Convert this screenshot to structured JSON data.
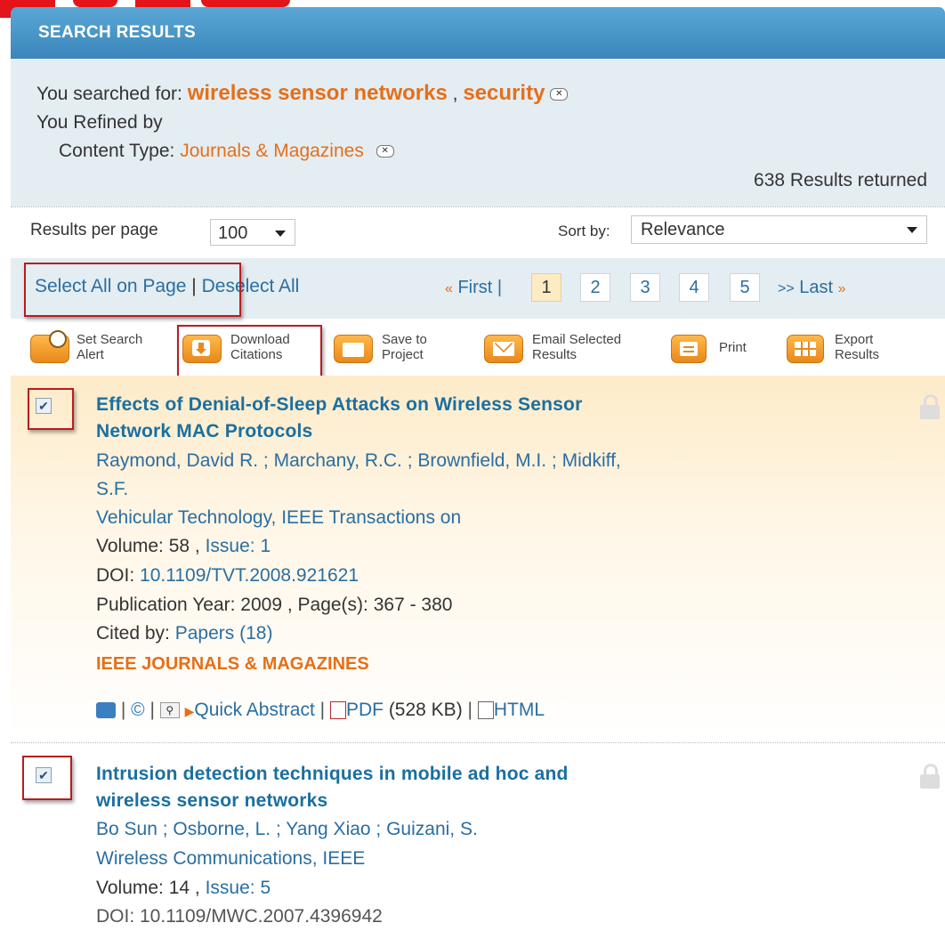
{
  "header": {
    "title": "SEARCH RESULTS"
  },
  "summary": {
    "searched_label": "You searched for:",
    "terms": [
      "wireless sensor networks",
      "security"
    ],
    "term_sep": ",",
    "refined_label": "You Refined by",
    "content_type_label": "Content Type:",
    "content_type_value": "Journals & Magazines",
    "results_count": "638 Results returned"
  },
  "controls": {
    "per_page_label": "Results per page",
    "per_page_value": "100",
    "sort_label": "Sort by:",
    "sort_value": "Relevance"
  },
  "selection": {
    "select_all": "Select All on Page",
    "separator": "|",
    "deselect_all": "Deselect All"
  },
  "pagination": {
    "first_prefix": "«",
    "first": "First",
    "first_sep": "|",
    "pages": [
      "1",
      "2",
      "3",
      "4",
      "5"
    ],
    "current": "1",
    "last_prefix": ">>",
    "last": "Last",
    "last_suffix": "»"
  },
  "toolbar": {
    "set_alert": [
      "Set Search",
      "Alert"
    ],
    "download": [
      "Download",
      "Citations"
    ],
    "save": [
      "Save to",
      "Project"
    ],
    "email": [
      "Email Selected",
      "Results"
    ],
    "print": "Print",
    "export": [
      "Export",
      "Results"
    ]
  },
  "results": [
    {
      "title_lines": [
        "Effects of Denial-of-Sleep Attacks on Wireless Sensor",
        "Network MAC Protocols"
      ],
      "authors_lines": [
        "Raymond, David R. ; Marchany, R.C. ; Brownfield, M.I. ; Midkiff,",
        "S.F."
      ],
      "publication": "Vehicular Technology, IEEE Transactions on",
      "volume_label": "Volume: 58",
      "issue_label": "Issue: 1",
      "doi_label": "DOI:",
      "doi": "10.1109/TVT.2008.921621",
      "year_pages": "Publication Year: 2009 , Page(s): 367 - 380",
      "cited_label": "Cited by:",
      "cited_link": "Papers (18)",
      "type": "IEEE JOURNALS & MAGAZINES",
      "quick_abstract": "Quick Abstract",
      "pdf": "PDF",
      "pdf_size": "(528 KB)",
      "html": "HTML",
      "checked": true
    },
    {
      "title_lines": [
        "Intrusion detection techniques in mobile ad hoc and",
        "wireless sensor networks"
      ],
      "authors": "Bo Sun ; Osborne, L. ; Yang Xiao ; Guizani, S.",
      "publication": "Wireless Communications, IEEE",
      "volume_label": "Volume: 14",
      "issue_label": "Issue: 5",
      "doi_partial": "DOI: 10.1109/MWC.2007.4396942",
      "checked": true
    }
  ],
  "colors": {
    "accent": "#e56f19",
    "link": "#2a6ea1",
    "header": "#4a95c8",
    "highlight": "#b91c1f"
  }
}
